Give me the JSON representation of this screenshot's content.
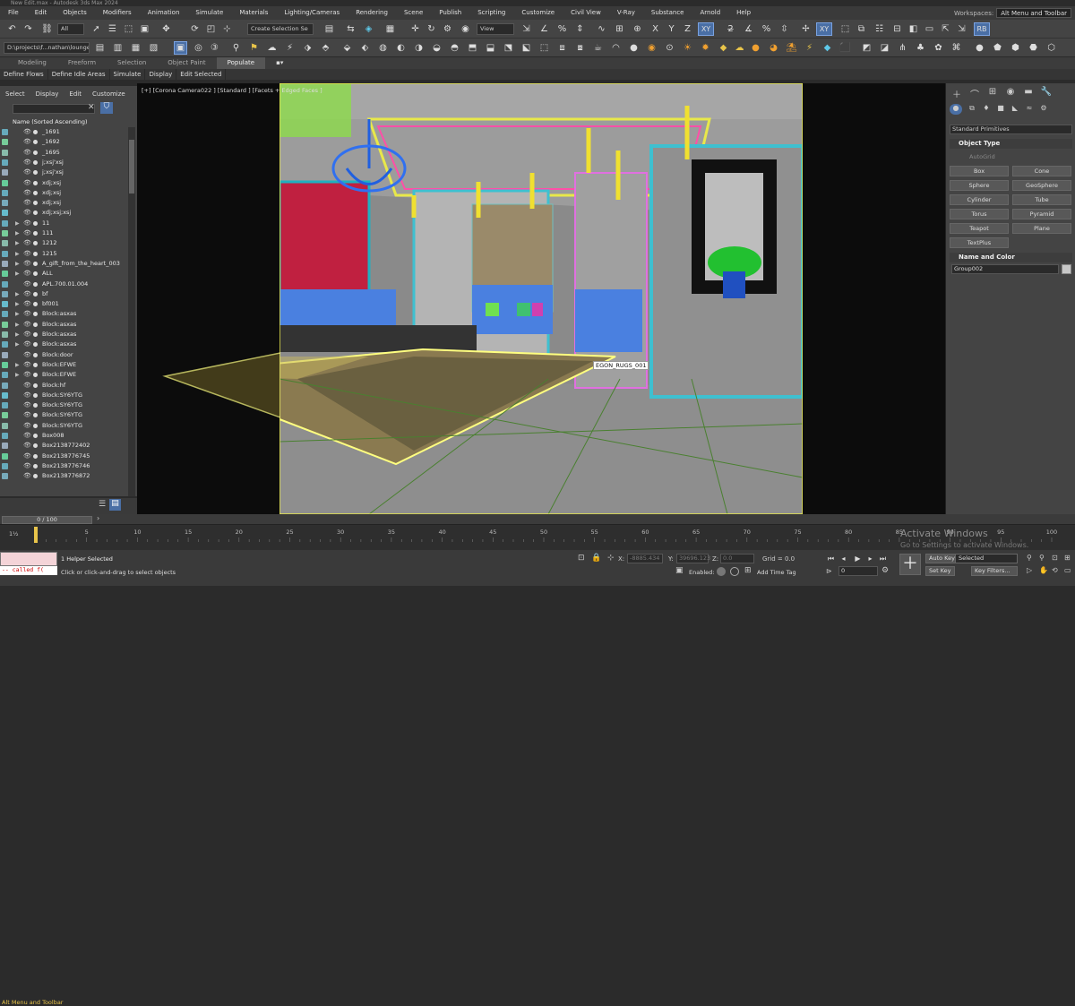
{
  "title_bar": "New Edit.max - Autodesk 3ds Max 2024",
  "menu": [
    "File",
    "Edit",
    "Objects",
    "Modifiers",
    "Animation",
    "Simulate",
    "Materials",
    "Lighting/Cameras",
    "Rendering",
    "Scene",
    "Publish",
    "Scripting",
    "Customize",
    "Civil View",
    "V-Ray",
    "Substance",
    "Arnold",
    "Help"
  ],
  "workspace": {
    "label": "Workspaces:",
    "value": "Alt Menu and Toolbar"
  },
  "toolbar": {
    "filter_all": "All",
    "selection_set": "Create Selection Se",
    "view": "View",
    "xy_label": "XY",
    "project_path": "D:\\projects\\f...nathan\\lounge",
    "rb_label": "RB"
  },
  "ribbon_tabs": [
    "Modeling",
    "Freeform",
    "Selection",
    "Object Paint",
    "Populate"
  ],
  "ribbon_active": "Populate",
  "subbar": [
    "Define Flows",
    "Define Idle Areas",
    "Simulate",
    "Display",
    "Edit Selected"
  ],
  "scene_explorer": {
    "tabs": [
      "Select",
      "Display",
      "Edit",
      "Customize"
    ],
    "sort_label": "Name (Sorted Ascending)",
    "rows": [
      {
        "name": "_1691",
        "arrow": ""
      },
      {
        "name": "_1692",
        "arrow": ""
      },
      {
        "name": "_1695",
        "arrow": ""
      },
      {
        "name": "j;xsj'xsj",
        "arrow": ""
      },
      {
        "name": "j;xsj'xsj",
        "arrow": ""
      },
      {
        "name": "xdj;xsj",
        "arrow": ""
      },
      {
        "name": "xdj;xsj",
        "arrow": ""
      },
      {
        "name": "xdj;xsj",
        "arrow": ""
      },
      {
        "name": "xdj;xsj;xsj",
        "arrow": ""
      },
      {
        "name": "11",
        "arrow": "▶"
      },
      {
        "name": "111",
        "arrow": "▶"
      },
      {
        "name": "1212",
        "arrow": "▶"
      },
      {
        "name": "1215",
        "arrow": "▶"
      },
      {
        "name": "A_gift_from_the_heart_003",
        "arrow": "▶"
      },
      {
        "name": "ALL",
        "arrow": "▶"
      },
      {
        "name": "APL.700.01.004",
        "arrow": ""
      },
      {
        "name": "bf",
        "arrow": "▶"
      },
      {
        "name": "bf001",
        "arrow": "▶"
      },
      {
        "name": "Block:asxas",
        "arrow": "▶"
      },
      {
        "name": "Block:asxas",
        "arrow": "▶"
      },
      {
        "name": "Block:asxas",
        "arrow": "▶"
      },
      {
        "name": "Block:asxas",
        "arrow": "▶"
      },
      {
        "name": "Block:door",
        "arrow": ""
      },
      {
        "name": "Block:EFWE",
        "arrow": "▶"
      },
      {
        "name": "Block:EFWE",
        "arrow": "▶"
      },
      {
        "name": "Block:hf",
        "arrow": ""
      },
      {
        "name": "Block:SY6YTG",
        "arrow": ""
      },
      {
        "name": "Block:SY6YTG",
        "arrow": ""
      },
      {
        "name": "Block:SY6YTG",
        "arrow": ""
      },
      {
        "name": "Block:SY6YTG",
        "arrow": ""
      },
      {
        "name": "Box008",
        "arrow": ""
      },
      {
        "name": "Box2138772402",
        "arrow": ""
      },
      {
        "name": "Box2138776745",
        "arrow": ""
      },
      {
        "name": "Box2138776746",
        "arrow": ""
      },
      {
        "name": "Box2138776872",
        "arrow": ""
      }
    ]
  },
  "alt_menu": "Alt Menu and Toolbar",
  "viewport": {
    "label": "[+] [Corona Camera022 ] [Standard ] [Facets + Edged Faces ]",
    "rug_tag": "EGON_RUGS_001"
  },
  "command_panel": {
    "dropdown": "Standard Primitives",
    "object_type": "Object Type",
    "autogrid": "AutoGrid",
    "buttons": [
      "Box",
      "Cone",
      "Sphere",
      "GeoSphere",
      "Cylinder",
      "Tube",
      "Torus",
      "Pyramid",
      "Teapot",
      "Plane",
      "TextPlus"
    ],
    "name_and_color": "Name and Color",
    "object_name": "Group002"
  },
  "timeline": {
    "frame": "0 / 100",
    "ticks": [
      0,
      5,
      10,
      15,
      20,
      25,
      30,
      35,
      40,
      45,
      50,
      55,
      60,
      65,
      70,
      75,
      80,
      85,
      90,
      95,
      100
    ],
    "start_label": "1⅟₂"
  },
  "status": {
    "maxscript": "-- called f(",
    "selection": "1 Helper Selected",
    "prompt": "Click or click-and-drag to select objects",
    "x_label": "X:",
    "x_value": "-8885.434",
    "y_label": "Y:",
    "y_value": "39696.123",
    "z_label": "Z:",
    "z_value": "0.0",
    "grid": "Grid = 0.0",
    "enabled": "Enabled:",
    "add_time_tag": "Add Time Tag",
    "auto_key": "Auto Key",
    "selected": "Selected",
    "set_key": "Set Key",
    "key_filters": "Key Filters...",
    "frame_field": "0",
    "activate_title": "Activate Windows",
    "activate_sub": "Go to Settings to activate Windows."
  }
}
